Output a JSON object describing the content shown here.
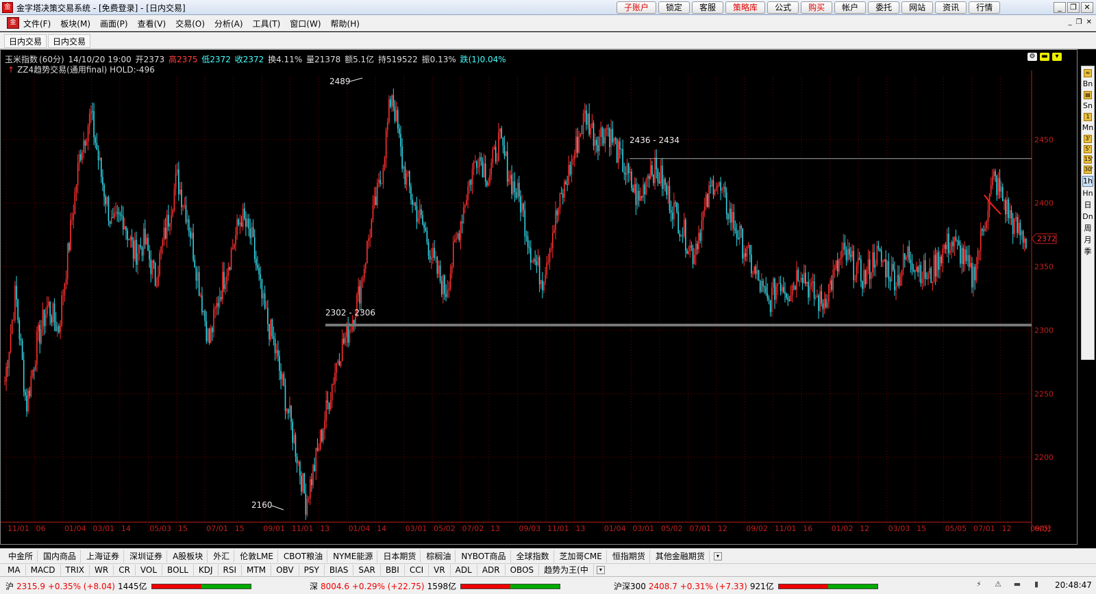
{
  "window": {
    "title": "金字塔决策交易系统 - [免费登录] - [日内交易]",
    "top_buttons": [
      "子账户",
      "锁定",
      "客服",
      "策略库",
      "公式",
      "购买",
      "帐户",
      "委托",
      "网站",
      "资讯",
      "行情"
    ],
    "win_ctrls": [
      "_",
      "❐",
      "✕"
    ]
  },
  "menu": {
    "items": [
      "文件(F)",
      "板块(M)",
      "画面(P)",
      "查看(V)",
      "交易(O)",
      "分析(A)",
      "工具(T)",
      "窗口(W)",
      "帮助(H)"
    ],
    "mdi_ctrls": [
      "_",
      "❐",
      "✕"
    ]
  },
  "tabs": [
    "日内交易",
    "日内交易"
  ],
  "quote": {
    "symbol": "玉米指数",
    "period": "(60分)",
    "datetime": "14/10/20 19:00",
    "open": "开2373",
    "high": "高2375",
    "low": "低2372",
    "close": "收2372",
    "turnover": "换4.11%",
    "volume": "量21378",
    "amount": "额5.1亿",
    "hold": "持519522",
    "amplitude": "振0.13%",
    "change": "跌(1)0.04%"
  },
  "strategy": {
    "label": "ZZ4趋势交易(通用final) HOLD:-496"
  },
  "chart_data": {
    "type": "candlestick",
    "symbol": "玉米指数",
    "period": "60分",
    "y_ticks": [
      2200,
      2250,
      2300,
      2350,
      2400,
      2450
    ],
    "ylim": [
      2150,
      2500
    ],
    "x_ticks": [
      "11/01",
      "06",
      "01/04",
      "03/01",
      "14",
      "05/03",
      "15",
      "07/01",
      "15",
      "09/01",
      "11/01",
      "13",
      "01/04",
      "14",
      "03/01",
      "05/02",
      "07/02",
      "13",
      "09/03",
      "11/01",
      "13",
      "01/04",
      "03/01",
      "05/02",
      "07/01",
      "12",
      "09/02",
      "11/01",
      "16",
      "01/02",
      "12",
      "03/03",
      "15",
      "05/05",
      "07/01",
      "12",
      "09/01"
    ],
    "annotations": [
      {
        "text": "2489",
        "value": 2489
      },
      {
        "text": "2160",
        "value": 2160
      },
      {
        "text": "2436 - 2434",
        "value": 2435
      },
      {
        "text": "2302 - 2306",
        "value": 2304
      }
    ],
    "last_price": "2372",
    "period_label": "60分",
    "price_path": [
      2260,
      2330,
      2240,
      2290,
      2320,
      2300,
      2370,
      2440,
      2470,
      2420,
      2380,
      2390,
      2360,
      2370,
      2340,
      2380,
      2420,
      2390,
      2340,
      2290,
      2330,
      2360,
      2390,
      2370,
      2320,
      2290,
      2250,
      2210,
      2165,
      2200,
      2240,
      2280,
      2300,
      2330,
      2380,
      2420,
      2489,
      2430,
      2400,
      2380,
      2350,
      2330,
      2370,
      2410,
      2440,
      2420,
      2450,
      2420,
      2400,
      2360,
      2340,
      2380,
      2410,
      2440,
      2470,
      2450,
      2460,
      2440,
      2420,
      2400,
      2430,
      2420,
      2400,
      2380,
      2360,
      2390,
      2420,
      2400,
      2380,
      2360,
      2340,
      2320,
      2340,
      2330,
      2350,
      2330,
      2320,
      2340,
      2360,
      2350,
      2340,
      2360,
      2350,
      2340,
      2360,
      2350,
      2340,
      2360,
      2370,
      2360,
      2340,
      2380,
      2420,
      2400,
      2380,
      2372
    ],
    "candle_colors": {
      "up": "#ff3030",
      "down": "#30d8e8"
    }
  },
  "right_toolbar": [
    "Bn",
    "Sn",
    "Mn",
    "3'",
    "5'",
    "15'",
    "30'",
    "1h",
    "Hn",
    "日",
    "Dn",
    "周",
    "月",
    "季"
  ],
  "sectors": [
    "中金所",
    "国内商品",
    "上海证券",
    "深圳证券",
    "A股板块",
    "外汇",
    "伦敦LME",
    "CBOT粮油",
    "NYME能源",
    "日本期货",
    "棕榈油",
    "NYBOT商品",
    "全球指数",
    "芝加哥CME",
    "恒指期货",
    "其他金融期货"
  ],
  "indicators": [
    "MA",
    "MACD",
    "TRIX",
    "WR",
    "CR",
    "VOL",
    "BOLL",
    "KDJ",
    "RSI",
    "MTM",
    "OBV",
    "PSY",
    "BIAS",
    "SAR",
    "BBI",
    "CCI",
    "VR",
    "ADL",
    "ADR",
    "OBOS",
    "趋势为王(中"
  ],
  "status": {
    "sh": {
      "name": "沪",
      "value": "2315.9 +0.35% (+8.04)",
      "amount": "1445亿"
    },
    "sz": {
      "name": "深",
      "value": "8004.6 +0.29% (+22.75)",
      "amount": "1598亿"
    },
    "hs300": {
      "name": "沪深300",
      "value": "2408.7 +0.31% (+7.33)",
      "amount": "921亿"
    },
    "time": "20:48:47"
  }
}
